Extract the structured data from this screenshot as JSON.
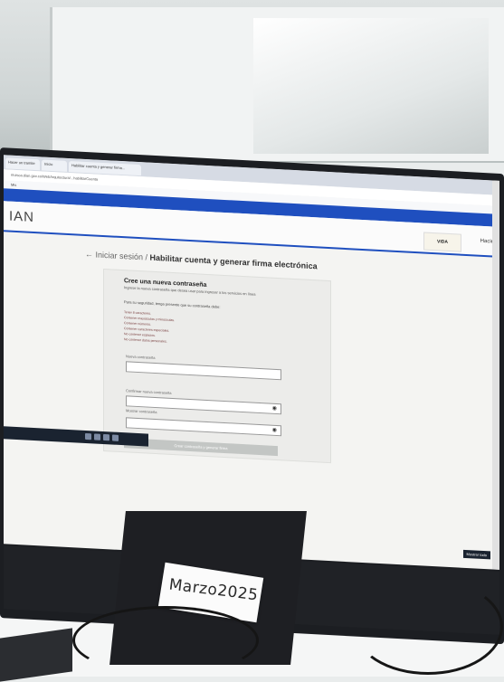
{
  "browser": {
    "tabs": [
      "Hacer un tramite",
      "Inicio",
      "Habilitar cuenta y generar firma..."
    ],
    "url": "muisca.dian.gov.co/WebArquitectura/...habilitarCuenta",
    "bookmark": "Mis"
  },
  "site": {
    "brand": "IAN",
    "badge": "VIDA",
    "minciencia": "Hacie"
  },
  "page": {
    "back_link": "← Iniciar sesión /",
    "title": "Habilitar cuenta y generar firma electrónica"
  },
  "form": {
    "heading": "Cree una nueva contraseña",
    "subtitle": "Ingrese la nueva contraseña que desea usar para ingresar a los servicios en línea",
    "instruction": "Para su seguridad, tenga presente que su contraseña debe:",
    "rules": [
      "Tener 8 caracteres.",
      "Contener mayúsculas y minúsculas.",
      "Contener números.",
      "Contener caracteres especiales.",
      "No contener espacios.",
      "No contener datos personales."
    ],
    "field1_label": "Nueva contraseña",
    "field2_label": "Confirmar nueva contraseña",
    "show_label": "Mostrar contraseña",
    "submit": "Crear contraseña y generar firma"
  },
  "taskbar": {
    "notice": "Mostrar todo"
  },
  "handwritten_note": "Marzo2025"
}
